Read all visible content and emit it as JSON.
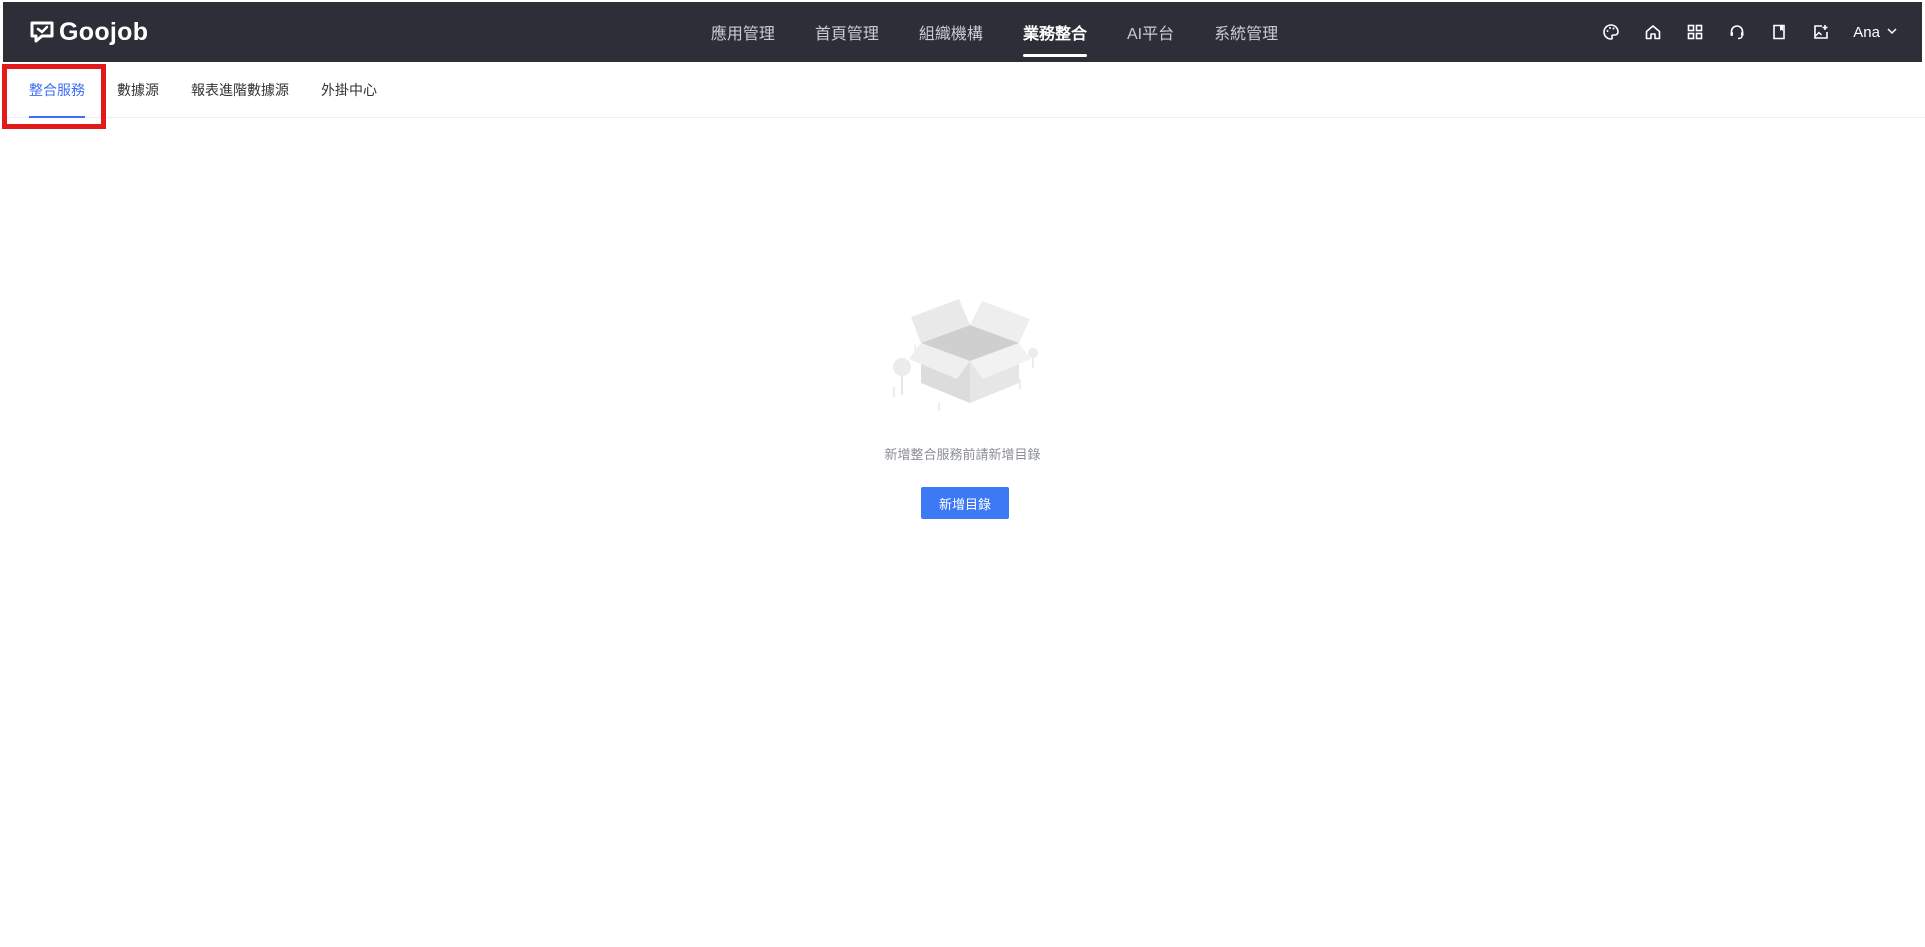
{
  "app": {
    "brand": "Goojob"
  },
  "topnav": {
    "items": [
      {
        "label": "應用管理"
      },
      {
        "label": "首頁管理"
      },
      {
        "label": "組織機構"
      },
      {
        "label": "業務整合",
        "active": true
      },
      {
        "label": "AI平台"
      },
      {
        "label": "系統管理"
      }
    ],
    "tools": [
      "palette-icon",
      "home-icon",
      "apps-grid-icon",
      "support-icon",
      "document-icon",
      "image-add-icon"
    ],
    "user": {
      "name": "Ana"
    }
  },
  "subtabs": {
    "items": [
      {
        "label": "整合服務",
        "active": true
      },
      {
        "label": "數據源"
      },
      {
        "label": "報表進階數據源"
      },
      {
        "label": "外掛中心"
      }
    ]
  },
  "empty_state": {
    "message": "新增整合服務前請新增目錄",
    "button_label": "新增目錄",
    "illustration": "empty-box-illustration"
  },
  "colors": {
    "topbar_bg": "#2c2f37",
    "accent": "#3d6ff2",
    "button": "#3d78f5",
    "highlight": "#e21a1a"
  }
}
